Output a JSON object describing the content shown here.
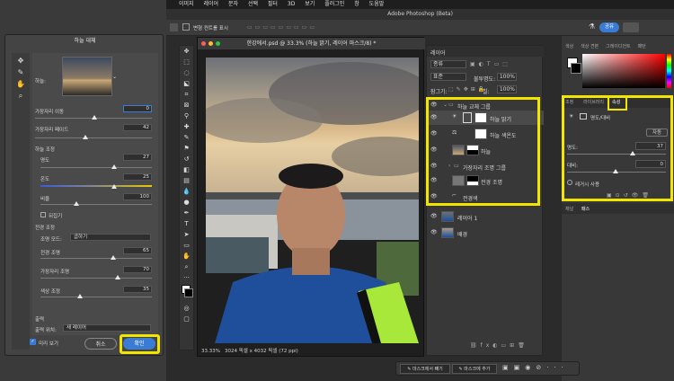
{
  "menubar": {
    "items": [
      "이미지",
      "레이어",
      "문자",
      "선택",
      "필터",
      "3D",
      "보기",
      "플러그인",
      "창",
      "도움말"
    ]
  },
  "app_title": "Adobe Photoshop (Beta)",
  "options_bar": {
    "label": "변형 컨트롤 표시",
    "share": "공유"
  },
  "dialog": {
    "title": "하늘 대체",
    "sky_label": "하늘:",
    "move_edge": {
      "label": "가장자리 이동",
      "value": "0"
    },
    "fade_edge": {
      "label": "가장자리 페이드",
      "value": "42"
    },
    "sky_adjust": {
      "label": "하늘 조정"
    },
    "brightness": {
      "label": "명도",
      "value": "27"
    },
    "temperature": {
      "label": "온도",
      "value": "25"
    },
    "scale": {
      "label": "비율",
      "value": "100"
    },
    "flip": {
      "label": "뒤집기"
    },
    "foreground_adjust": {
      "label": "전경 조정"
    },
    "lighting_mode": {
      "label": "조명 모드:",
      "value": "곱하기"
    },
    "foreground_light": {
      "label": "전경 조명",
      "value": "65"
    },
    "edge_light": {
      "label": "가장자리 조명",
      "value": "70"
    },
    "color_adjust": {
      "label": "색상 조정",
      "value": "35"
    },
    "output": {
      "label": "출력",
      "to_label": "출력 위치:",
      "to_value": "새 레이어"
    },
    "preview": {
      "label": "미리 보기"
    },
    "cancel": "취소",
    "ok": "확인"
  },
  "document": {
    "tab_title": "한강에서.psd @ 33.3% (하늘 밝기, 레이어 마스크/8) *",
    "zoom": "33.33%",
    "size": "3024 픽셀 x 4032 픽셀 (72 ppi)"
  },
  "layers_panel": {
    "tab": "레이어",
    "kind": "종류",
    "blend_mode": "표준",
    "opacity_label": "불투명도:",
    "opacity": "100%",
    "lock_label": "잠그기:",
    "fill_label": "칠:",
    "fill": "100%",
    "layers": [
      {
        "name": "하늘 교체 그룹"
      },
      {
        "name": "하늘 밝기"
      },
      {
        "name": "하늘 색온도"
      },
      {
        "name": "하늘"
      },
      {
        "name": "가장자리 조명 그룹"
      },
      {
        "name": "전경 조명"
      },
      {
        "name": "전경색"
      },
      {
        "name": "레이어 1"
      },
      {
        "name": "배경"
      }
    ]
  },
  "right_panels": {
    "color_tabs": [
      "색상",
      "색상 견본",
      "그레이디언트",
      "패턴"
    ],
    "props_tabs": [
      "조정",
      "라이브러리",
      "속성"
    ],
    "brightness_title": "명도/대비",
    "auto": "자동",
    "brightness_label": "명도:",
    "brightness_value": "37",
    "contrast_label": "대비:",
    "contrast_value": "0",
    "legacy": "레거시 사용",
    "bottom_tabs": [
      "채널",
      "패스"
    ]
  },
  "colors": {
    "highlight": "#f2e600",
    "accent": "#3a7bd5",
    "panel": "#383838"
  }
}
